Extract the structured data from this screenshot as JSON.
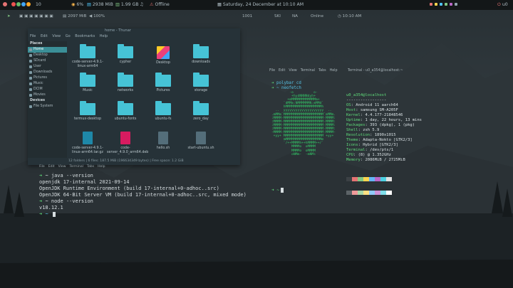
{
  "colors": {
    "accent": "#46c3d6",
    "prompt": "#5fdc7a",
    "bar": "#131718"
  },
  "topbar": {
    "workspace_count": "10",
    "cpu": "6%",
    "mem": "2938 MiB",
    "gb": "1.99 GB",
    "net": "Offline",
    "clock": "Saturday, 24 December at 10:10 AM",
    "user": "u0"
  },
  "bar2": {
    "disk": "2097 MiB",
    "vol": "100%",
    "n1": "1001",
    "n2": "SKI",
    "na": "NA",
    "online": "Online",
    "time": "10:10 AM"
  },
  "filemanager": {
    "title": "home - Thunar",
    "menu": [
      "File",
      "Edit",
      "View",
      "Go",
      "Bookmarks",
      "Help"
    ],
    "places_header": "Places",
    "places": [
      "Home",
      "Desktop",
      "SDcard",
      "User",
      "Downloads",
      "Pictures",
      "Music",
      "DCIM",
      "Movies"
    ],
    "devices_header": "Devices",
    "devices": [
      "File System"
    ],
    "items": [
      {
        "label": "code-server-4.9.1-linux-arm64",
        "type": "folder"
      },
      {
        "label": "cypher",
        "type": "folder"
      },
      {
        "label": "Desktop",
        "type": "special"
      },
      {
        "label": "downloads",
        "type": "folder"
      },
      {
        "label": "Music",
        "type": "folder"
      },
      {
        "label": "networks",
        "type": "folder"
      },
      {
        "label": "Pictures",
        "type": "folder"
      },
      {
        "label": "storage",
        "type": "folder"
      },
      {
        "label": "termux-desktop",
        "type": "folder"
      },
      {
        "label": "ubuntu-fonts",
        "type": "folder"
      },
      {
        "label": "ubuntu-fs",
        "type": "folder"
      },
      {
        "label": "zero_day",
        "type": "folder"
      },
      {
        "label": "code-server-4.9.1-linux-arm64.tar.gz",
        "type": "archive"
      },
      {
        "label": "code-server_4.9.0_arm64.deb",
        "type": "deb"
      },
      {
        "label": "hello.sh",
        "type": "script"
      },
      {
        "label": "start-ubuntu.sh",
        "type": "script"
      }
    ],
    "status": "12 folders | 6 files: 187.5 MiB (196634349 bytes) | Free space: 1.2 GiB"
  },
  "terminal_left": {
    "menu": [
      "File",
      "Edit",
      "View",
      "Terminal",
      "Tabs",
      "Help"
    ],
    "lines": [
      {
        "type": "prompt",
        "text": "~ java --version"
      },
      {
        "type": "out",
        "text": "openjdk 17-internal 2021-09-14"
      },
      {
        "type": "out",
        "text": "OpenJDK Runtime Environment (build 17-internal+0-adhoc..src)"
      },
      {
        "type": "out",
        "text": "OpenJDK 64-Bit Server VM (build 17-internal+0-adhoc..src, mixed mode)"
      },
      {
        "type": "prompt",
        "text": "~ node --version"
      },
      {
        "type": "out",
        "text": "v18.12.1"
      },
      {
        "type": "prompt",
        "text": "~ "
      }
    ]
  },
  "terminal_right": {
    "title": "Terminal - u0_a354@localhost:~",
    "menu": [
      "File",
      "Edit",
      "View",
      "Terminal",
      "Tabs",
      "Help"
    ],
    "commands": [
      "polybar cd",
      "~ neofetch"
    ],
    "userhost": "u0_a354@localhost",
    "separator": "-----------------",
    "info": [
      {
        "k": "OS",
        "v": "Android 11 aarch64"
      },
      {
        "k": "Host",
        "v": "samsung SM-A205F"
      },
      {
        "k": "Kernel",
        "v": "4.4.177-21848546"
      },
      {
        "k": "Uptime",
        "v": "1 day, 22 hours, 13 mins"
      },
      {
        "k": "Packages",
        "v": "393 (dpkg), 1 (pkg)"
      },
      {
        "k": "Shell",
        "v": "zsh 5.9"
      },
      {
        "k": "Resolution",
        "v": "1890x1015"
      },
      {
        "k": "Theme",
        "v": "Adapta-Nokto [GTK2/3]"
      },
      {
        "k": "Icons",
        "v": "Hybrid [GTK2/3]"
      },
      {
        "k": "Terminal",
        "v": "/dev/pts/1"
      },
      {
        "k": "CPU",
        "v": "(8) @ 1.352GHz"
      },
      {
        "k": "Memory",
        "v": "2086MiB / 2725MiB"
      }
    ],
    "ascii": "          -o          o-\n           +hydNNNNdyh+\n         +mMMMMMMMMMMMMm+\n       `dMMm:NMMMMMMN:mMMd`\n       hMMMMMMMMMMMMMMMMMMh\n   ..  yyyyyyyyyyyyyyyyyyyy  ..\n .mMMm`MMMMMMMMMMMMMMMMMMMM`mMMm.\n :MMMM-MMMMMMMMMMMMMMMMMMMM-MMMM:\n :MMMM-MMMMMMMMMMMMMMMMMMMM-MMMM:\n :MMMM-MMMMMMMMMMMMMMMMMMMM-MMMM:\n :MMMM-MMMMMMMMMMMMMMMMMMMM-MMMM:\n -MMMM-MMMMMMMMMMMMMMMMMMMM-MMMM-\n  +yy+ MMMMMMMMMMMMMMMMMMMM +yy+\n       mMMMMMMMMMMMMMMMMMMm\n       `/++MMMMh++hMMMM++/`\n           MMMMo  oMMMM\n           MMMMo  oMMMM\n           oNMm-  -mNMs",
    "swatches": [
      "#3c4145",
      "#e57373",
      "#81c784",
      "#ffd54f",
      "#64b5f6",
      "#ba68c8",
      "#4dd0e1",
      "#e0e0e0",
      "#5c6367",
      "#ef9a9a",
      "#a5d6a7",
      "#ffe082",
      "#90caf9",
      "#ce93d8",
      "#80deea",
      "#ffffff"
    ]
  }
}
